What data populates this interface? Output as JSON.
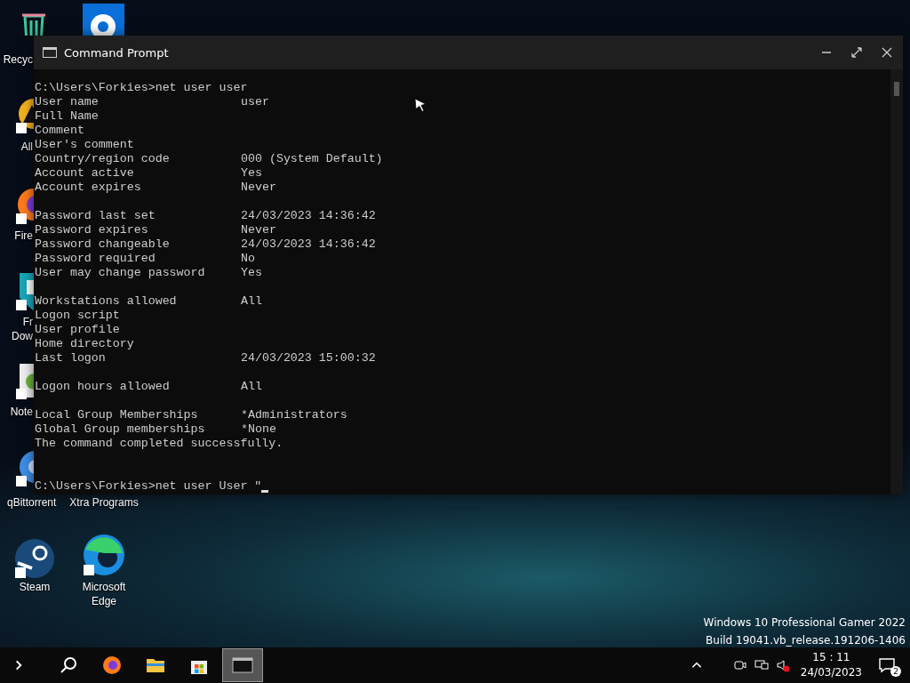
{
  "desktop": {
    "icons": [
      {
        "kind": "recycle",
        "label": "Recyc"
      },
      {
        "kind": "settings"
      },
      {
        "kind": "app-a",
        "label": "All"
      },
      {
        "kind": "firefox",
        "label": "Fire"
      },
      {
        "kind": "download",
        "label": "Fr Dow"
      },
      {
        "kind": "notepad",
        "label": "Note"
      },
      {
        "kind": "qbit",
        "label": "qBittorrent"
      },
      {
        "kind": "folder",
        "label": "Xtra Programs"
      },
      {
        "kind": "steam",
        "label": "Steam"
      },
      {
        "kind": "edge",
        "label": "Microsoft Edge"
      }
    ],
    "watermark": [
      "Windows 10 Professional Gamer 2022",
      "Build 19041.vb_release.191206-1406"
    ]
  },
  "window": {
    "title": "Command Prompt",
    "lines": [
      {
        "kind": "command",
        "text": "C:\\Users\\Forkies>net user user"
      },
      {
        "kind": "field",
        "label": "User name",
        "value": "user"
      },
      {
        "kind": "field",
        "label": "Full Name"
      },
      {
        "kind": "field",
        "label": "Comment"
      },
      {
        "kind": "field",
        "label": "User's comment"
      },
      {
        "kind": "field",
        "label": "Country/region code",
        "value": "000 (System Default)"
      },
      {
        "kind": "field",
        "label": "Account active",
        "value": "Yes"
      },
      {
        "kind": "field",
        "label": "Account expires",
        "value": "Never"
      },
      {
        "kind": "blank"
      },
      {
        "kind": "field",
        "label": "Password last set",
        "value": "24/03/2023 14:36:42"
      },
      {
        "kind": "field",
        "label": "Password expires",
        "value": "Never"
      },
      {
        "kind": "field",
        "label": "Password changeable",
        "value": "24/03/2023 14:36:42"
      },
      {
        "kind": "field",
        "label": "Password required",
        "value": "No"
      },
      {
        "kind": "field",
        "label": "User may change password",
        "value": "Yes"
      },
      {
        "kind": "blank"
      },
      {
        "kind": "field",
        "label": "Workstations allowed",
        "value": "All"
      },
      {
        "kind": "field",
        "label": "Logon script"
      },
      {
        "kind": "field",
        "label": "User profile"
      },
      {
        "kind": "field",
        "label": "Home directory"
      },
      {
        "kind": "field",
        "label": "Last logon",
        "value": "24/03/2023 15:00:32"
      },
      {
        "kind": "blank"
      },
      {
        "kind": "field",
        "label": "Logon hours allowed",
        "value": "All"
      },
      {
        "kind": "blank"
      },
      {
        "kind": "field",
        "label": "Local Group Memberships",
        "value": "*Administrators"
      },
      {
        "kind": "field",
        "label": "Global Group memberships",
        "value": "*None"
      },
      {
        "kind": "text",
        "text": "The command completed successfully."
      },
      {
        "kind": "blank"
      },
      {
        "kind": "blank"
      },
      {
        "kind": "prompt",
        "text": "C:\\Users\\Forkies>net user User \""
      }
    ]
  },
  "taskbar": {
    "apps": [
      {
        "kind": "search",
        "selected": false
      },
      {
        "kind": "firefox",
        "selected": false
      },
      {
        "kind": "explorer",
        "selected": false
      },
      {
        "kind": "store",
        "selected": false
      },
      {
        "kind": "cmd",
        "selected": true
      }
    ],
    "time": "15 : 11",
    "date": "24/03/2023",
    "notifications": "2"
  }
}
